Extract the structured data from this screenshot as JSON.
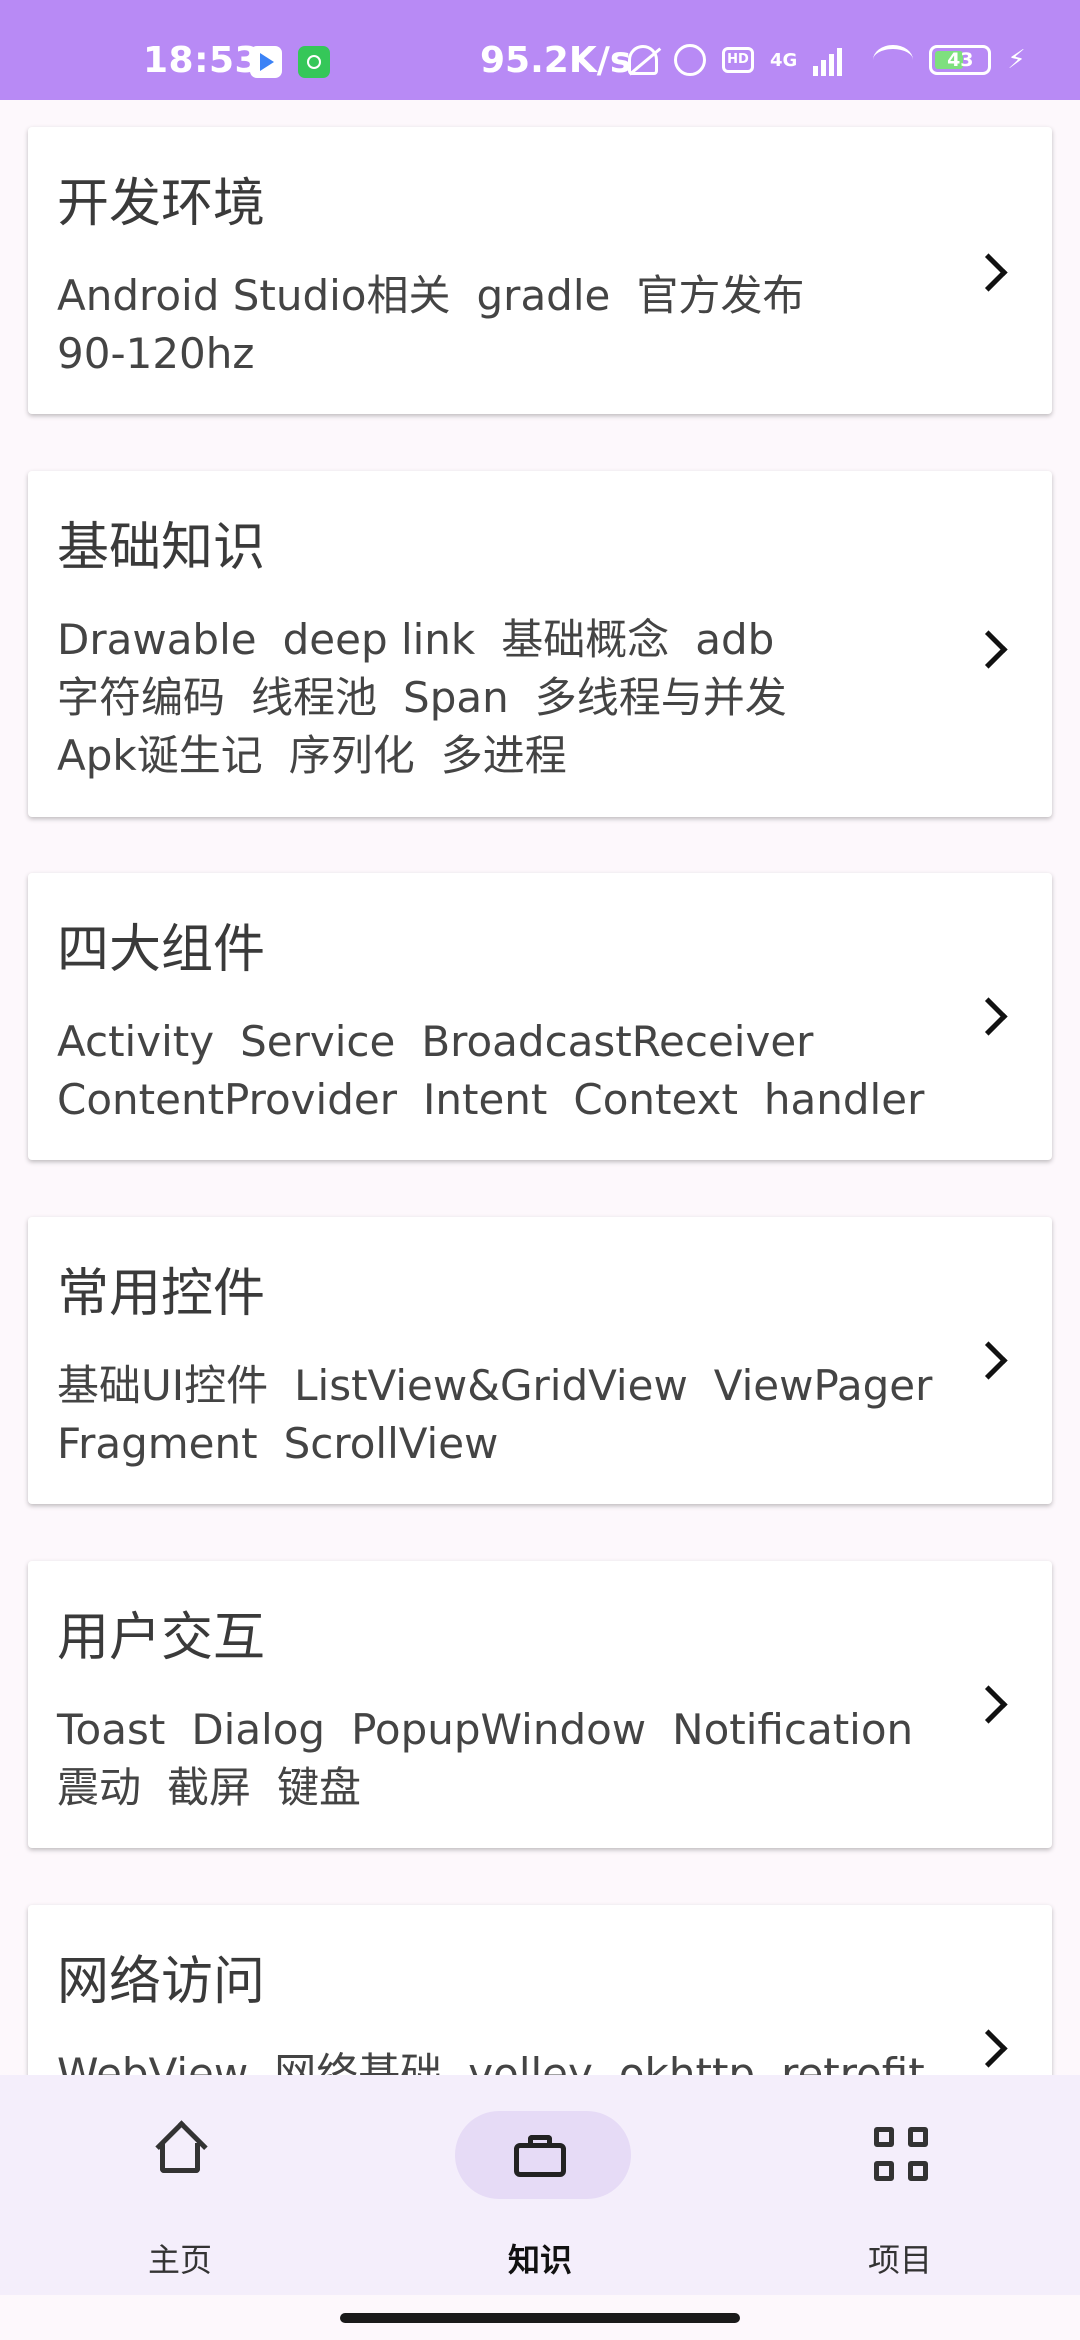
{
  "status_bar": {
    "time": "18:53",
    "net_speed": "95.2K/s",
    "hd": "HD",
    "network": "4G",
    "battery": "43",
    "bolt": "⚡"
  },
  "cards": [
    {
      "title": "开发环境",
      "tags": [
        "Android Studio相关",
        "gradle",
        "官方发布",
        "90-120hz"
      ]
    },
    {
      "title": "基础知识",
      "tags": [
        "Drawable",
        "deep link",
        "基础概念",
        "adb",
        "字符编码",
        "线程池",
        "Span",
        "多线程与并发",
        "Apk诞生记",
        "序列化",
        "多进程"
      ]
    },
    {
      "title": "四大组件",
      "tags": [
        "Activity",
        "Service",
        "BroadcastReceiver",
        "ContentProvider",
        "Intent",
        "Context",
        "handler"
      ]
    },
    {
      "title": "常用控件",
      "tags": [
        "基础UI控件",
        "ListView&GridView",
        "ViewPager",
        "Fragment",
        "ScrollView"
      ]
    },
    {
      "title": "用户交互",
      "tags": [
        "Toast",
        "Dialog",
        "PopupWindow",
        "Notification",
        "震动",
        "截屏",
        "键盘"
      ]
    },
    {
      "title": "网络访问",
      "tags": [
        "WebView",
        "网络基础",
        "volley",
        "okhttp",
        "retrofit"
      ]
    }
  ],
  "bottom_nav": {
    "items": [
      {
        "label": "主页",
        "icon": "home-icon"
      },
      {
        "label": "知识",
        "icon": "briefcase-icon",
        "active": true
      },
      {
        "label": "项目",
        "icon": "grid-icon"
      }
    ]
  }
}
